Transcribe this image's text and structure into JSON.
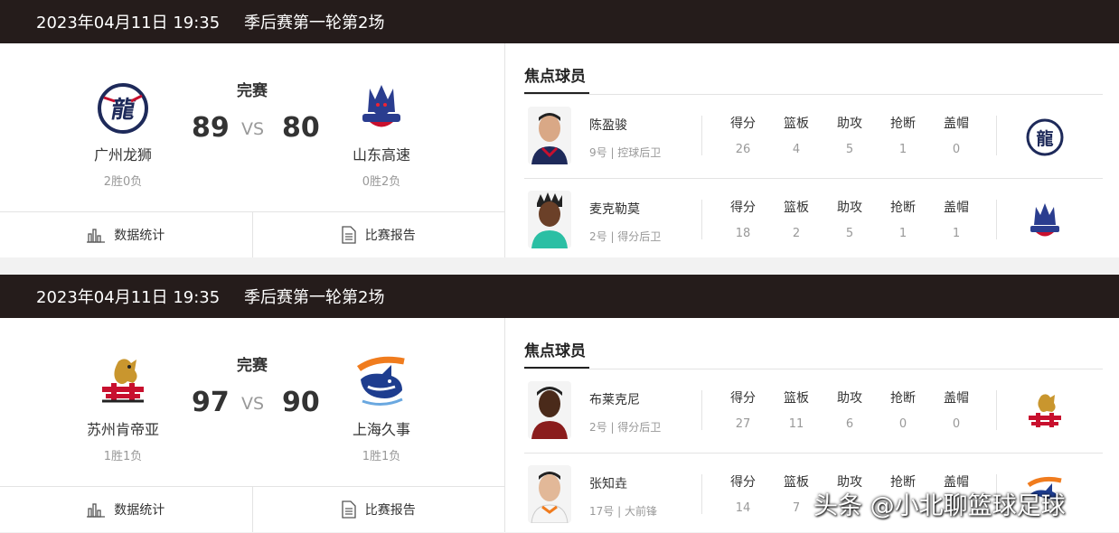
{
  "games": [
    {
      "date": "2023年04月11日 19:35",
      "round": "季后赛第一轮第2场",
      "status": "完赛",
      "vs": "VS",
      "home": {
        "name": "广州龙狮",
        "record": "2胜0负",
        "score": "89"
      },
      "away": {
        "name": "山东高速",
        "record": "0胜2负",
        "score": "80"
      },
      "buttons": {
        "stats": "数据统计",
        "report": "比赛报告"
      },
      "focus_title": "焦点球员",
      "players": [
        {
          "name": "陈盈骏",
          "info": "9号 | 控球后卫",
          "stats": [
            "26",
            "4",
            "5",
            "1",
            "0"
          ]
        },
        {
          "name": "麦克勒莫",
          "info": "2号 | 得分后卫",
          "stats": [
            "18",
            "2",
            "5",
            "1",
            "1"
          ]
        }
      ]
    },
    {
      "date": "2023年04月11日 19:35",
      "round": "季后赛第一轮第2场",
      "status": "完赛",
      "vs": "VS",
      "home": {
        "name": "苏州肯帝亚",
        "record": "1胜1负",
        "score": "97"
      },
      "away": {
        "name": "上海久事",
        "record": "1胜1负",
        "score": "90"
      },
      "buttons": {
        "stats": "数据统计",
        "report": "比赛报告"
      },
      "focus_title": "焦点球员",
      "players": [
        {
          "name": "布莱克尼",
          "info": "2号 | 得分后卫",
          "stats": [
            "27",
            "11",
            "6",
            "0",
            "0"
          ]
        },
        {
          "name": "张知垚",
          "info": "17号 | 大前锋",
          "stats": [
            "14",
            "7",
            "",
            "",
            ""
          ]
        }
      ]
    }
  ],
  "stat_labels": [
    "得分",
    "篮板",
    "助攻",
    "抢断",
    "盖帽"
  ],
  "watermark": "头条 @小北聊篮球足球",
  "colors": {
    "header_bg": "#251c1b",
    "page_bg": "#f2f2f2"
  }
}
